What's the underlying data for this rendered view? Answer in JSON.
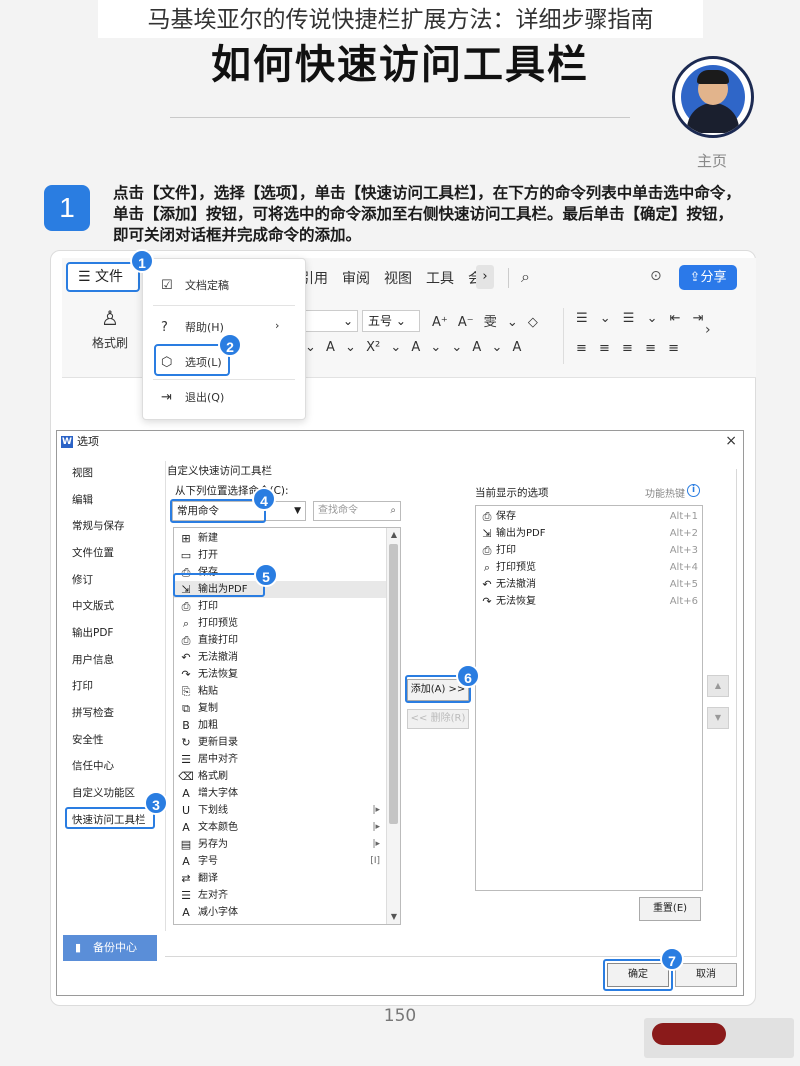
{
  "header": {
    "top_title": "马基埃亚尔的传说快捷栏扩展方法：详细步骤指南",
    "main_title": "如何快速访问工具栏",
    "home_label": "主页"
  },
  "step": {
    "number": "1",
    "text": "点击【文件】，选择【选项】，单击【快速访问工具栏】，在下方的命令列表中单击选中命令，单击【添加】按钮，可将选中的命令添加至右侧快速访问工具栏。最后单击【确定】按钮，即可关闭对话框并完成命令的添加。"
  },
  "callouts": [
    "1",
    "2",
    "3",
    "4",
    "5",
    "6",
    "7"
  ],
  "ribbon": {
    "file_tab": "文件",
    "tabs": [
      "引用",
      "审阅",
      "视图",
      "工具",
      "会"
    ],
    "share": "分享",
    "format_brush": "格式刷",
    "size_value": "五号",
    "tools_row1": "A⁺ A⁻ 雯 ⌄ ◇",
    "tools_row2": "⌄ A ⌄ X² ⌄ A ⌄ ⌄ A ⌄ A",
    "para_row1": "☰ ⌄ ☰ ⌄ ⇤ ⇥",
    "para_row2": "≡ ≡ ≡ ≡ ≡"
  },
  "file_menu": {
    "items": [
      "文档定稿",
      "帮助(H)",
      "选项(L)",
      "退出(Q)"
    ]
  },
  "dialog": {
    "title": "选项",
    "close": "×",
    "nav_items": [
      "视图",
      "编辑",
      "常规与保存",
      "文件位置",
      "修订",
      "中文版式",
      "输出PDF",
      "用户信息",
      "打印",
      "拼写检查",
      "安全性",
      "信任中心",
      "自定义功能区",
      "快速访问工具栏"
    ],
    "backup_center": "备份中心",
    "group_label": "自定义快速访问工具栏",
    "choose_label": "从下列位置选择命令(C):",
    "select_value": "常用命令",
    "search_placeholder": "查找命令",
    "commands": [
      {
        "icon": "⊞",
        "label": "新建",
        "sub": ""
      },
      {
        "icon": "▭",
        "label": "打开",
        "sub": ""
      },
      {
        "icon": "⎙",
        "label": "保存",
        "sub": ""
      },
      {
        "icon": "⇲",
        "label": "输出为PDF",
        "sub": ""
      },
      {
        "icon": "⎙",
        "label": "打印",
        "sub": ""
      },
      {
        "icon": "⌕",
        "label": "打印预览",
        "sub": ""
      },
      {
        "icon": "⎙",
        "label": "直接打印",
        "sub": ""
      },
      {
        "icon": "↶",
        "label": "无法撤消",
        "sub": ""
      },
      {
        "icon": "↷",
        "label": "无法恢复",
        "sub": ""
      },
      {
        "icon": "⎘",
        "label": "粘贴",
        "sub": ""
      },
      {
        "icon": "⧉",
        "label": "复制",
        "sub": ""
      },
      {
        "icon": "B",
        "label": "加粗",
        "sub": ""
      },
      {
        "icon": "↻",
        "label": "更新目录",
        "sub": ""
      },
      {
        "icon": "☰",
        "label": "居中对齐",
        "sub": ""
      },
      {
        "icon": "⌫",
        "label": "格式刷",
        "sub": ""
      },
      {
        "icon": "A",
        "label": "增大字体",
        "sub": ""
      },
      {
        "icon": "U",
        "label": "下划线",
        "sub": "|▸"
      },
      {
        "icon": "A",
        "label": "文本颜色",
        "sub": "|▸"
      },
      {
        "icon": "▤",
        "label": "另存为",
        "sub": "|▸"
      },
      {
        "icon": "A",
        "label": "字号",
        "sub": "[I]"
      },
      {
        "icon": "⇄",
        "label": "翻译",
        "sub": ""
      },
      {
        "icon": "☰",
        "label": "左对齐",
        "sub": ""
      },
      {
        "icon": "A",
        "label": "减小字体",
        "sub": ""
      }
    ],
    "add_button": "添加(A) >>",
    "remove_button": "<< 删除(R)",
    "current_label": "当前显示的选项",
    "hotkey_label": "功能热键",
    "current_items": [
      {
        "icon": "⎙",
        "label": "保存",
        "hotkey": "Alt+1"
      },
      {
        "icon": "⇲",
        "label": "输出为PDF",
        "hotkey": "Alt+2"
      },
      {
        "icon": "⎙",
        "label": "打印",
        "hotkey": "Alt+3"
      },
      {
        "icon": "⌕",
        "label": "打印预览",
        "hotkey": "Alt+4"
      },
      {
        "icon": "↶",
        "label": "无法撤消",
        "hotkey": "Alt+5"
      },
      {
        "icon": "↷",
        "label": "无法恢复",
        "hotkey": "Alt+6"
      }
    ],
    "reset_button": "重置(E)",
    "ok_button": "确定",
    "cancel_button": "取消"
  },
  "footer": {
    "page_number": "150"
  },
  "colors": {
    "accent": "#2a7de1",
    "share_button": "#2b79e9"
  }
}
